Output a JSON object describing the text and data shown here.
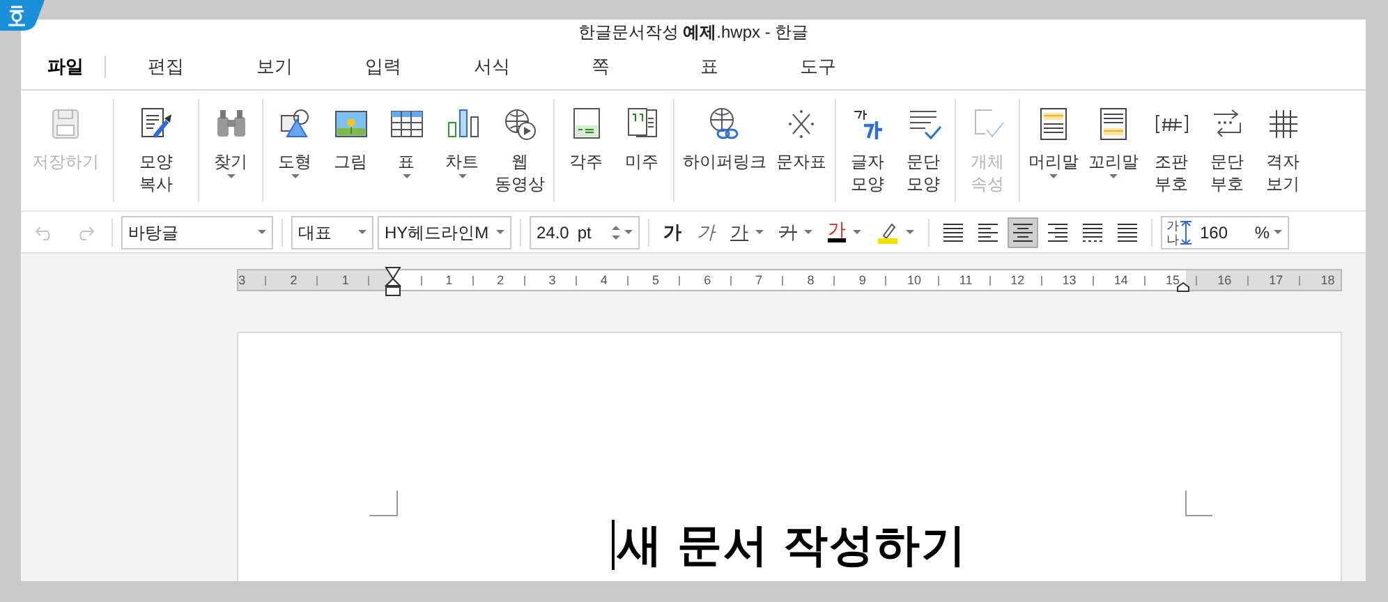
{
  "window": {
    "title": "한글문서작성 **예제**.hwpx - 한글"
  },
  "menu_tabs": [
    {
      "label": "파일",
      "selected": true
    },
    {
      "label": "편집",
      "selected": false
    },
    {
      "label": "보기",
      "selected": false
    },
    {
      "label": "입력",
      "selected": false
    },
    {
      "label": "서식",
      "selected": false
    },
    {
      "label": "쪽",
      "selected": false
    },
    {
      "label": "표",
      "selected": false
    },
    {
      "label": "도구",
      "selected": false
    }
  ],
  "ribbon_groups": [
    {
      "items": [
        {
          "label": "저장하기",
          "disabled": true,
          "dropdown": false
        }
      ]
    },
    {
      "items": [
        {
          "label": "모양\n복사",
          "disabled": false,
          "dropdown": false
        }
      ]
    },
    {
      "items": [
        {
          "label": "찾기",
          "disabled": false,
          "dropdown": true
        }
      ]
    },
    {
      "items": [
        {
          "label": "도형",
          "disabled": false,
          "dropdown": true
        },
        {
          "label": "그림",
          "disabled": false,
          "dropdown": false
        },
        {
          "label": "표",
          "disabled": false,
          "dropdown": true
        },
        {
          "label": "차트",
          "disabled": false,
          "dropdown": true
        },
        {
          "label": "웹\n동영상",
          "disabled": false,
          "dropdown": false
        }
      ]
    },
    {
      "items": [
        {
          "label": "각주",
          "disabled": false,
          "dropdown": false
        },
        {
          "label": "미주",
          "disabled": false,
          "dropdown": false
        }
      ]
    },
    {
      "items": [
        {
          "label": "하이퍼링크",
          "disabled": false,
          "dropdown": false
        },
        {
          "label": "문자표",
          "disabled": false,
          "dropdown": false
        }
      ]
    },
    {
      "items": [
        {
          "label": "글자\n모양",
          "disabled": false,
          "dropdown": false
        },
        {
          "label": "문단\n모양",
          "disabled": false,
          "dropdown": false
        }
      ]
    },
    {
      "items": [
        {
          "label": "개체\n속성",
          "disabled": true,
          "dropdown": false
        }
      ]
    },
    {
      "items": [
        {
          "label": "머리말",
          "disabled": false,
          "dropdown": true
        },
        {
          "label": "꼬리말",
          "disabled": false,
          "dropdown": true
        },
        {
          "label": "조판\n부호",
          "disabled": false,
          "dropdown": false
        },
        {
          "label": "문단\n부호",
          "disabled": false,
          "dropdown": false
        },
        {
          "label": "격자\n보기",
          "disabled": false,
          "dropdown": false
        }
      ]
    }
  ],
  "format_bar": {
    "undo": {
      "disabled": true
    },
    "redo": {
      "disabled": true
    },
    "style": "바탕글",
    "language": "대표",
    "font": "HY헤드라인M",
    "size": "24.0",
    "unit": "pt",
    "char_buttons": [
      {
        "kind": "bold",
        "label": "가",
        "dropdown": false
      },
      {
        "kind": "italic",
        "label": "가",
        "dropdown": false
      },
      {
        "kind": "underline",
        "label": "가",
        "dropdown": true
      },
      {
        "kind": "strike",
        "label": "가",
        "dropdown": true
      },
      {
        "kind": "color",
        "label": "가",
        "dropdown": true
      }
    ],
    "highlight": {
      "dropdown": true
    },
    "align_buttons": [
      {
        "selected": false
      },
      {
        "selected": false
      },
      {
        "selected": true
      },
      {
        "selected": false
      },
      {
        "selected": false
      },
      {
        "selected": false
      }
    ],
    "line_spacing": {
      "glyph_top": "가",
      "glyph_bottom": "나",
      "value": "160",
      "unit": "%"
    }
  },
  "ruler": {
    "labels": [
      "3",
      "2",
      "1",
      "1",
      "2",
      "3",
      "4",
      "5",
      "6",
      "7",
      "8",
      "9",
      "10",
      "11",
      "12",
      "13",
      "14",
      "15",
      "16",
      "17",
      "18"
    ]
  },
  "document": {
    "heading": "새 문서 작성하기"
  }
}
